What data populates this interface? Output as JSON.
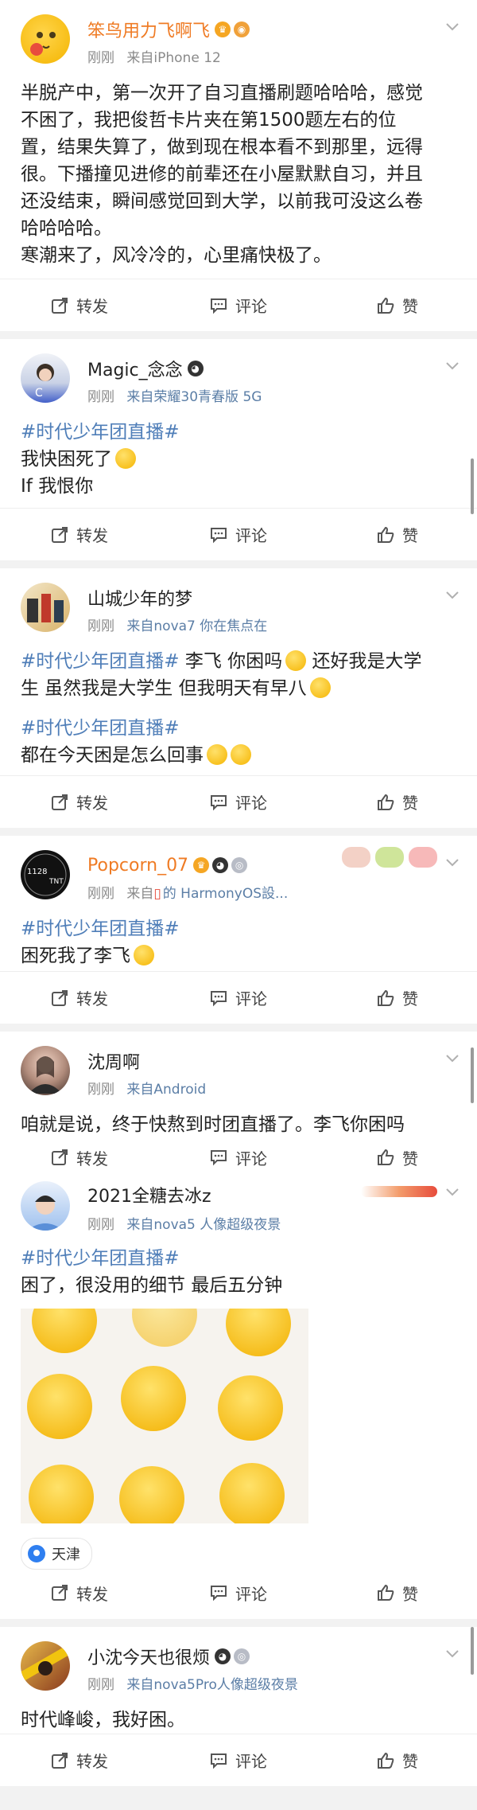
{
  "actions": {
    "repost": "转发",
    "comment": "评论",
    "like": "赞"
  },
  "posts": [
    {
      "username": "笨鸟用力飞啊飞",
      "time": "刚刚",
      "source": "来自iPhone 12",
      "lines": [
        "半脱产中，第一次开了自习直播刷题哈哈哈，感觉",
        "不困了，我把俊哲卡片夹在第1500题左右的位",
        "置，结果失算了，做到现在根本看不到那里，远得",
        "很。下播撞见进修的前辈还在小屋默默自习，并且",
        "还没结束，瞬间感觉回到大学，以前我可没这么卷",
        "哈哈哈哈。",
        "寒潮来了，风冷冷的，心里痛快极了。"
      ]
    },
    {
      "username": "Magic_念念",
      "time": "刚刚",
      "source": "来自荣耀30青春版 5G",
      "hashtag": "#时代少年团直播#",
      "line1": "我快困死了",
      "line2": "If 我恨你"
    },
    {
      "username": "山城少年的梦",
      "time": "刚刚",
      "source": "来自nova7 你在焦点在",
      "hashtag": "#时代少年团直播#",
      "text1a": " 李飞 你困吗",
      "text1b": " 还好我是大学",
      "text2": "生 虽然我是大学生 但我明天有早八",
      "hashtag2": "#时代少年团直播#",
      "text3": "都在今天困是怎么回事"
    },
    {
      "username": "Popcorn_07",
      "time": "刚刚",
      "source_prefix": "来自",
      "source": "的 HarmonyOS設...",
      "hashtag": "#时代少年团直播#",
      "text": "困死我了李飞"
    },
    {
      "username": "沈周啊",
      "time": "刚刚",
      "source": "来自Android",
      "text": "咱就是说，终于快熬到时团直播了。李飞你困吗"
    },
    {
      "username": "2021全糖去冰z",
      "time": "刚刚",
      "source": "来自nova5 人像超级夜景",
      "hashtag": "#时代少年团直播#",
      "text": "困了，很没用的细节 最后五分钟",
      "location": "天津"
    },
    {
      "username": "小沈今天也很烦",
      "time": "刚刚",
      "source": "来自nova5Pro人像超级夜景",
      "text": "时代峰峻，我好困。"
    }
  ]
}
